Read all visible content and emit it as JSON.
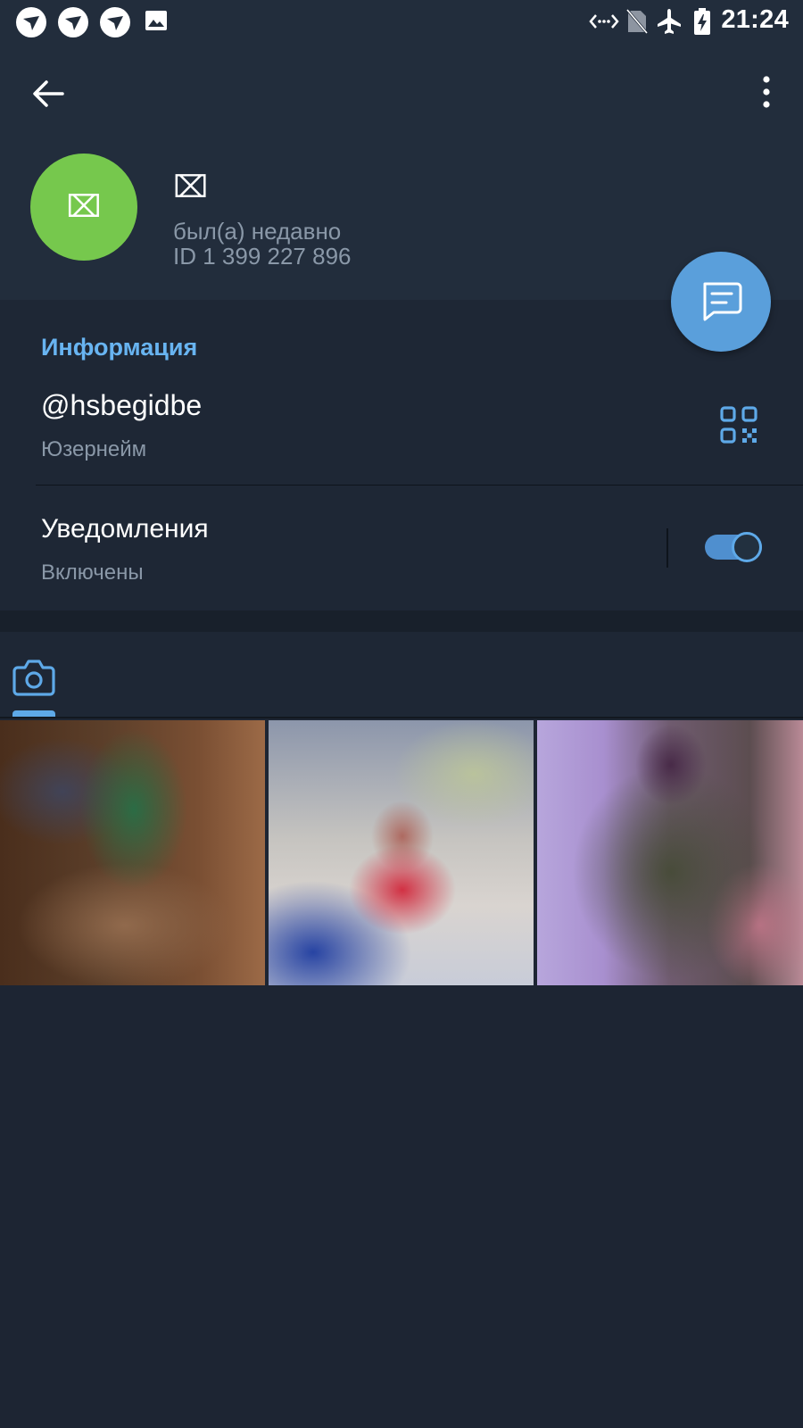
{
  "status_bar": {
    "time": "21:24",
    "notification_icons": [
      "app-notification-icon",
      "app-notification-icon",
      "app-notification-icon",
      "image-icon"
    ],
    "system_icons": [
      "data-transfer-icon",
      "no-sim-icon",
      "airplane-mode-icon",
      "battery-charging-icon"
    ]
  },
  "header": {
    "back_icon": "back-arrow-icon",
    "menu_icon": "more-vert-icon"
  },
  "profile": {
    "avatar_glyph": "⌧",
    "name": "⌧",
    "status": "был(а) недавно",
    "id_text": "ID 1 399 227 896",
    "avatar_color": "#76c84d"
  },
  "fab": {
    "icon": "message-icon",
    "color": "#5a9fdb"
  },
  "info": {
    "title": "Информация",
    "username": "@hsbegidbe",
    "username_label": "Юзернейм",
    "qr_icon": "qr-code-icon",
    "notifications_title": "Уведомления",
    "notifications_status": "Включены",
    "notifications_enabled": true
  },
  "media": {
    "active_tab_icon": "camera-icon",
    "photos": [
      "photo-1",
      "photo-2",
      "photo-3"
    ]
  },
  "colors": {
    "accent": "#68b4f1",
    "background": "#1d2533",
    "header": "#222d3c"
  }
}
